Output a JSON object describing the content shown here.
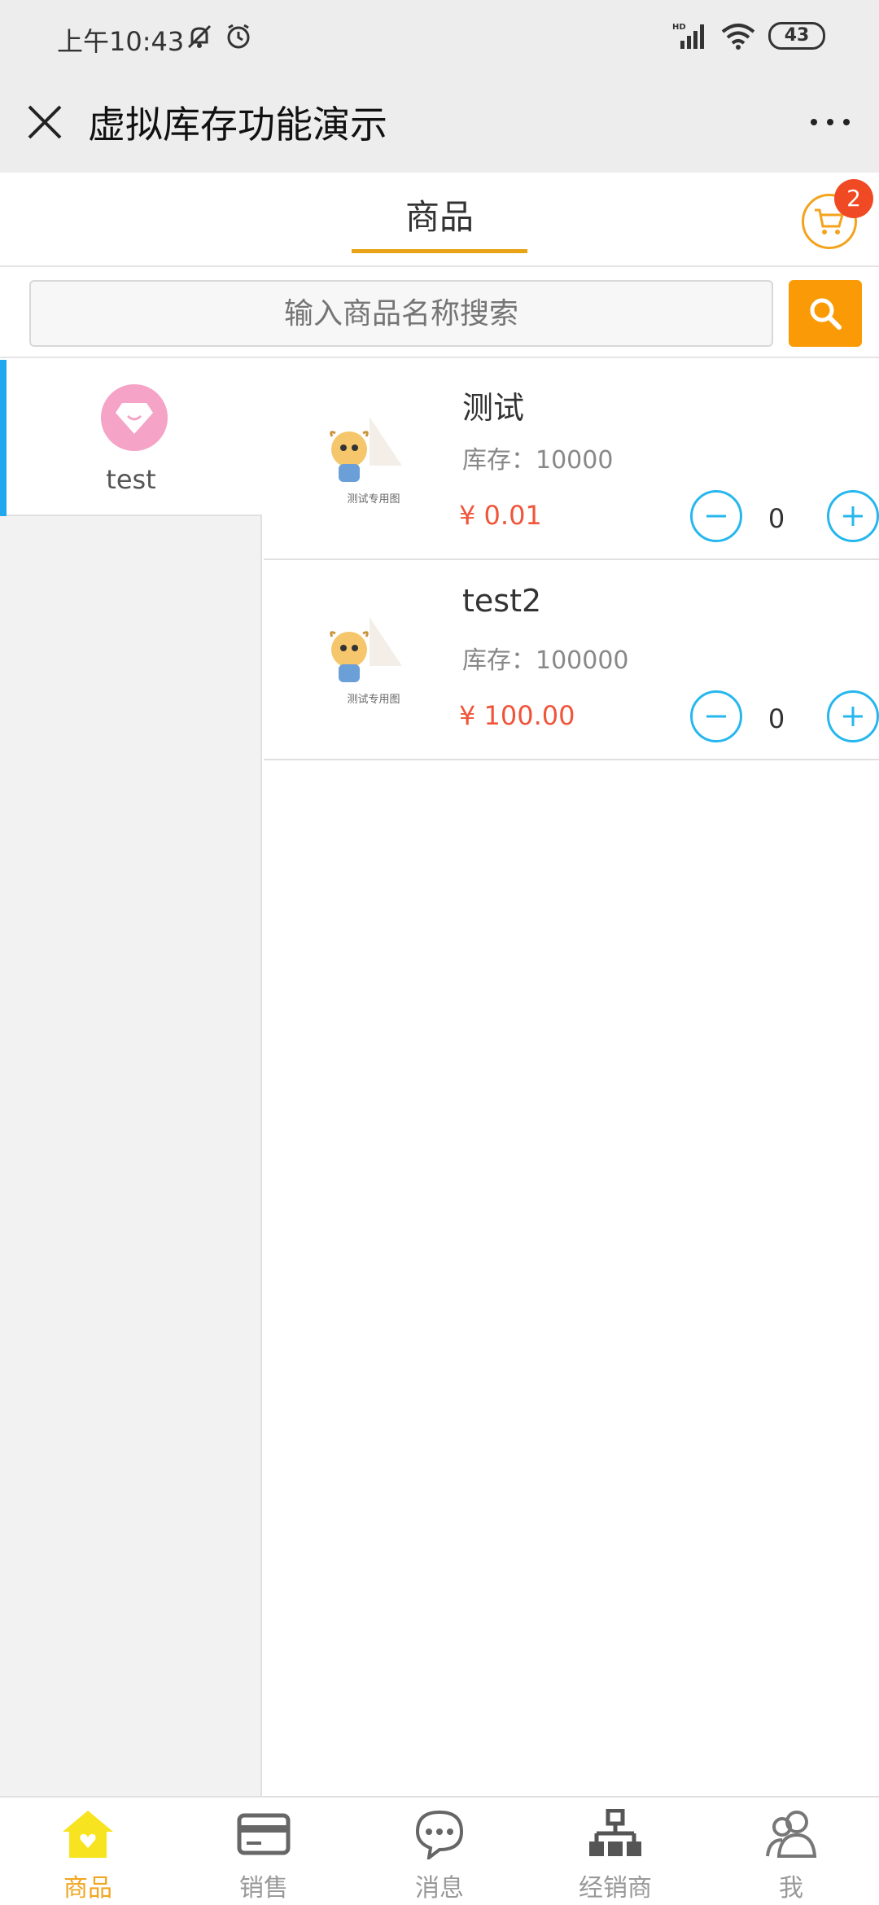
{
  "status_bar": {
    "time": "上午10:43",
    "battery": "43"
  },
  "title_bar": {
    "title": "虚拟库存功能演示"
  },
  "tabs": {
    "goods_label": "商品",
    "cart_count": "2"
  },
  "search": {
    "placeholder": "输入商品名称搜索"
  },
  "categories": [
    {
      "label": "test",
      "active": true
    }
  ],
  "products": [
    {
      "name": "测试",
      "stock": "库存：10000",
      "price": "¥ 0.01",
      "quantity": "0",
      "thumb_caption": "测试专用图"
    },
    {
      "name": "test2",
      "stock": "库存：100000",
      "price": "¥ 100.00",
      "quantity": "0",
      "thumb_caption": "测试专用图"
    }
  ],
  "bottom_nav": {
    "items": [
      {
        "label": "商品",
        "icon": "home-icon",
        "active": true
      },
      {
        "label": "销售",
        "icon": "card-icon",
        "active": false
      },
      {
        "label": "消息",
        "icon": "chat-icon",
        "active": false
      },
      {
        "label": "经销商",
        "icon": "network-icon",
        "active": false
      },
      {
        "label": "我",
        "icon": "users-icon",
        "active": false
      }
    ]
  },
  "colors": {
    "accent": "#f0a520",
    "search_button": "#fa9a06",
    "badge": "#f04a24",
    "price": "#f0553a",
    "stepper": "#25b7ee",
    "active_category_bar": "#1fa8f0"
  }
}
